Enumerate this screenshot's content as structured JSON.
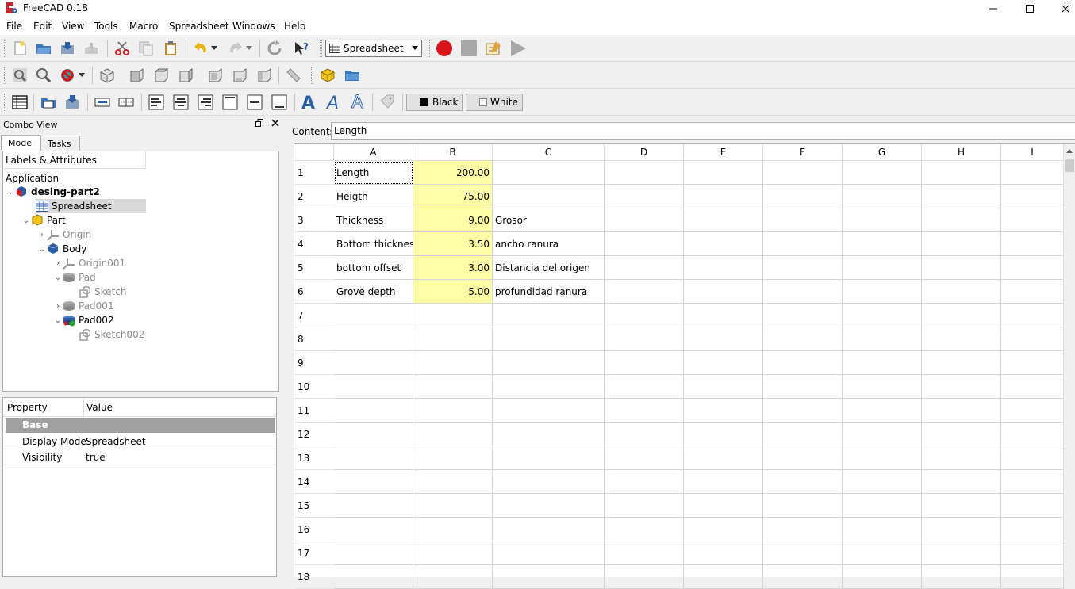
{
  "window": {
    "title": "FreeCAD 0.18"
  },
  "menu": [
    "File",
    "Edit",
    "View",
    "Tools",
    "Macro",
    "Spreadsheet",
    "Windows",
    "Help"
  ],
  "toolbar": {
    "workbench": "Spreadsheet",
    "color_black_label": "Black",
    "color_white_label": "White"
  },
  "combo": {
    "title": "Combo View",
    "tabs": [
      "Model",
      "Tasks"
    ],
    "tree_header": "Labels & Attributes",
    "tree": {
      "application": "Application",
      "document": "desing-part2",
      "items": [
        "Spreadsheet",
        "Part",
        "Origin",
        "Body",
        "Origin001",
        "Pad",
        "Sketch",
        "Pad001",
        "Pad002",
        "Sketch002"
      ]
    },
    "properties": {
      "col_property": "Property",
      "col_value": "Value",
      "group": "Base",
      "rows": [
        {
          "name": "Display Mode",
          "value": "Spreadsheet"
        },
        {
          "name": "Visibility",
          "value": "true"
        }
      ]
    }
  },
  "sheet": {
    "contents_label": "Contents",
    "contents_value": "Length",
    "columns": [
      "A",
      "B",
      "C",
      "D",
      "E",
      "F",
      "G",
      "H",
      "I"
    ],
    "row_numbers": [
      "1",
      "2",
      "3",
      "4",
      "5",
      "6",
      "7",
      "8",
      "9",
      "10",
      "11",
      "12",
      "13",
      "14",
      "15",
      "16",
      "17",
      "18"
    ],
    "rows": [
      {
        "a": "Length",
        "b": "200.00",
        "c": ""
      },
      {
        "a": "Heigth",
        "b": "75.00",
        "c": ""
      },
      {
        "a": "Thickness",
        "b": "9.00",
        "c": "Grosor"
      },
      {
        "a": "Bottom thickness",
        "b": "3.50",
        "c": "ancho ranura"
      },
      {
        "a": "bottom offset",
        "b": "3.00",
        "c": "Distancia del origen"
      },
      {
        "a": "Grove depth",
        "b": "5.00",
        "c": "profundidad ranura"
      }
    ]
  }
}
